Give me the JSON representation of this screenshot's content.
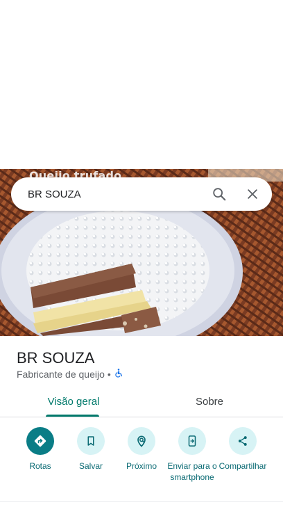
{
  "hero": {
    "caption": "Queijo trufado"
  },
  "search": {
    "query": "BR SOUZA"
  },
  "place": {
    "title": "BR SOUZA",
    "category": "Fabricante de queijo",
    "separator": "•"
  },
  "tabs": [
    {
      "label": "Visão geral",
      "active": true
    },
    {
      "label": "Sobre",
      "active": false
    }
  ],
  "actions": [
    {
      "label": "Rotas",
      "icon": "directions-icon"
    },
    {
      "label": "Salvar",
      "icon": "bookmark-icon"
    },
    {
      "label": "Próximo",
      "icon": "nearby-icon"
    },
    {
      "label": "Enviar para o smartphone",
      "icon": "send-to-phone-icon"
    },
    {
      "label": "Compartilhar",
      "icon": "share-icon"
    }
  ],
  "colors": {
    "accent": "#00796b",
    "action_primary": "#0a7d86",
    "action_bg": "#d7f3f5",
    "accessibility": "#1a73e8"
  }
}
